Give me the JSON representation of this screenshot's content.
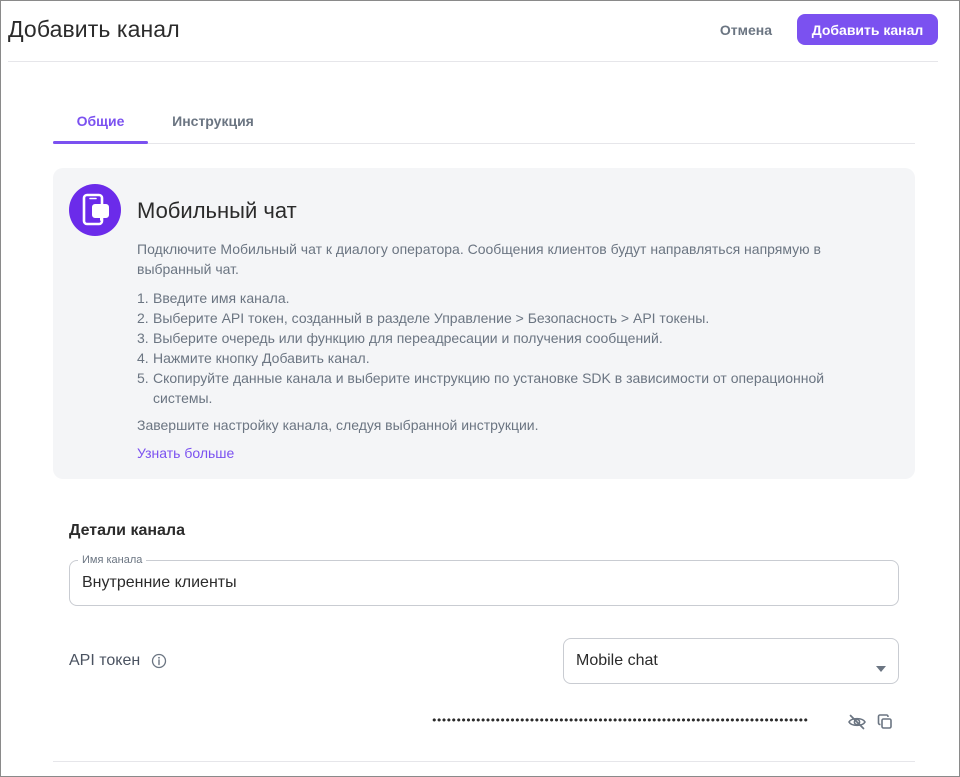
{
  "header": {
    "title": "Добавить канал",
    "cancel_label": "Отмена",
    "submit_label": "Добавить канал"
  },
  "tabs": [
    {
      "label": "Общие",
      "active": true
    },
    {
      "label": "Инструкция",
      "active": false
    }
  ],
  "info_card": {
    "icon": "mobile-chat-icon",
    "title": "Мобильный чат",
    "description": "Подключите Мобильный чат к диалогу оператора. Сообщения клиентов будут направляться напрямую в выбранный чат.",
    "steps": [
      {
        "num": "1.",
        "text": "Введите имя канала."
      },
      {
        "num": "2.",
        "text": "Выберите API токен, созданный в разделе Управление > Безопасность > API токены."
      },
      {
        "num": "3.",
        "text": "Выберите очередь или функцию для переадресации и получения сообщений."
      },
      {
        "num": "4.",
        "text": "Нажмите кнопку Добавить канал."
      },
      {
        "num": "5.",
        "text": "Скопируйте данные канала и выберите инструкцию по установке SDK в зависимости от операционной системы."
      }
    ],
    "finish_text": "Завершите настройку канала, следуя выбранной инструкции.",
    "learn_more": "Узнать больше"
  },
  "details": {
    "section_title": "Детали канала",
    "channel_name": {
      "label": "Имя канала",
      "value": "Внутренние клиенты"
    },
    "api_token": {
      "label": "API токен",
      "info_icon": "info-icon",
      "selected": "Mobile chat",
      "masked_value": "•••••••••••••••••••••••••••••••••••••••••••••••••••••••••••••••••••••••••••••"
    }
  },
  "colors": {
    "accent": "#7b51f0",
    "icon_bg": "#6b2bea",
    "muted_text": "#6b7582",
    "card_bg": "#f4f5f7"
  }
}
